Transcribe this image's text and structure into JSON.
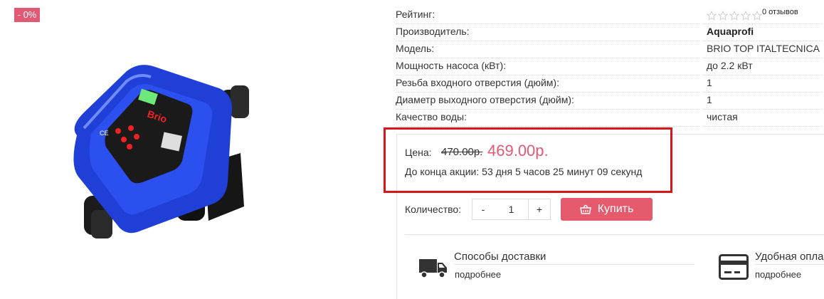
{
  "badge": {
    "discount": "- 0%"
  },
  "product": {
    "image_alt": "Brio Top pump controller"
  },
  "specs": [
    {
      "label": "Рейтинг:",
      "value": ""
    },
    {
      "label": "Производитель:",
      "value": "Aquaprofi"
    },
    {
      "label": "Модель:",
      "value": "BRIO TOP ITALTECNICA"
    },
    {
      "label": "Мощность насоса (кВт):",
      "value": "до 2.2 кВт"
    },
    {
      "label": "Резьба входного отверстия (дюйм):",
      "value": "1"
    },
    {
      "label": "Диаметр выходного отверстия (дюйм):",
      "value": "1"
    },
    {
      "label": "Качество воды:",
      "value": "чистая"
    }
  ],
  "rating": {
    "stars": 0,
    "max_stars": 5,
    "reviews": "0 отзывов"
  },
  "price": {
    "label": "Цена:",
    "old": "470.00р.",
    "new": "469.00р.",
    "countdown": "До конца акции: 53 дня 5 часов 25 минут 09 секунд"
  },
  "cart": {
    "qty_label": "Количество:",
    "minus": "-",
    "plus": "+",
    "qty_value": "1",
    "buy_label": "Купить"
  },
  "features": [
    {
      "title": "Способы доставки",
      "more": "подробнее",
      "icon": "truck-icon"
    },
    {
      "title": "Удобная опла",
      "more": "подробнее",
      "icon": "credit-card-icon"
    }
  ],
  "colors": {
    "accent": "#e65a6e",
    "price": "#e05a74",
    "highlight": "#d9141b"
  }
}
